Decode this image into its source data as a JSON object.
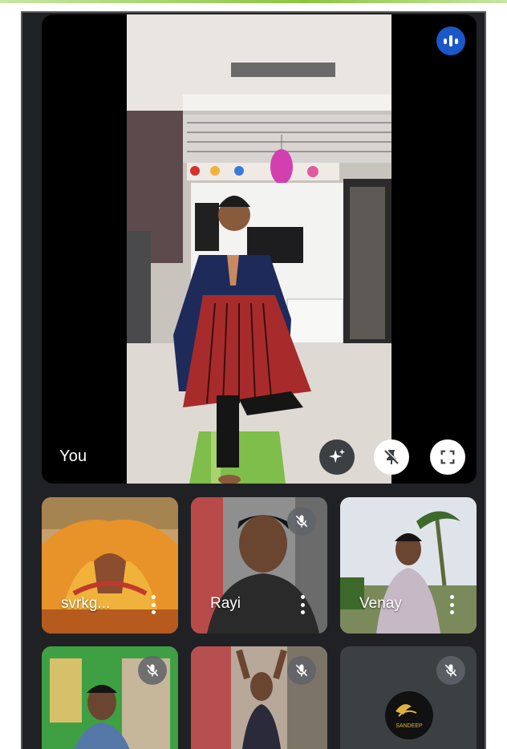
{
  "main_tile": {
    "label": "You",
    "speaking_icon": "speaking-indicator-icon",
    "controls": [
      {
        "name": "effects-button",
        "icon": "sparkle-icon"
      },
      {
        "name": "unpin-button",
        "icon": "pin-off-icon"
      },
      {
        "name": "fullscreen-button",
        "icon": "fullscreen-icon"
      }
    ]
  },
  "participants": [
    {
      "name": "svrkg...",
      "muted": false
    },
    {
      "name": "Rayi",
      "muted": true
    },
    {
      "name": "Venay",
      "muted": false
    },
    {
      "name": "",
      "muted": true
    },
    {
      "name": "",
      "muted": true
    },
    {
      "name": "",
      "muted": true
    }
  ],
  "logo_text": "SANDEEP",
  "colors": {
    "background": "#202124",
    "tile": "#3c4043",
    "accent_blue": "#1a57c8",
    "text": "#ffffff"
  }
}
